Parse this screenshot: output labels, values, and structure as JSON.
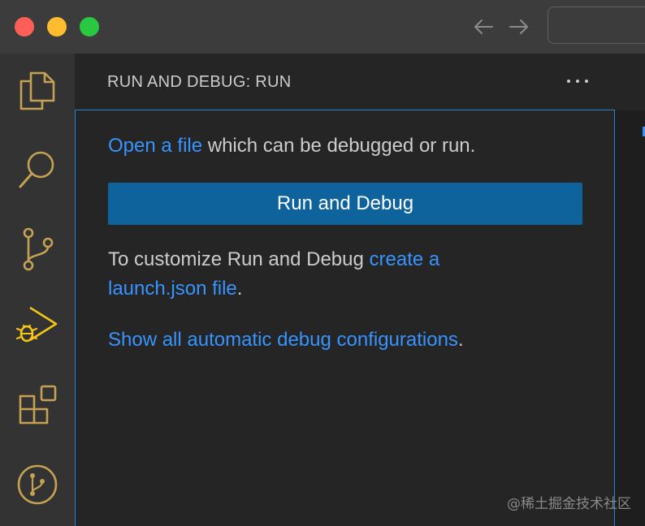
{
  "sidebar": {
    "title": "RUN AND DEBUG: RUN",
    "open_file_link": "Open a file",
    "open_file_rest": " which can be debugged or run.",
    "run_button": "Run and Debug",
    "customize_text": "To customize Run and Debug ",
    "create_link_1": "create a",
    "create_link_2": "launch.json file",
    "period_1": ".",
    "show_all_link": "Show all automatic debug configurations",
    "period_2": "."
  },
  "activitybar": {
    "icons": [
      "explorer-icon",
      "search-icon",
      "source-control-icon",
      "run-debug-icon",
      "extensions-icon",
      "git-graph-icon"
    ]
  },
  "watermark": "@稀土掘金技术社区",
  "colors": {
    "accent": "#3794ff",
    "button": "#0e639c",
    "icon": "#c5a253",
    "focus_border": "#1f85d8"
  }
}
